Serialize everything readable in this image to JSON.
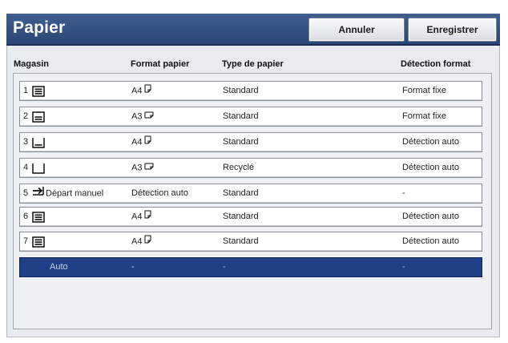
{
  "window": {
    "title": "Papier"
  },
  "buttons": {
    "cancel": "Annuler",
    "save": "Enregistrer"
  },
  "columns": {
    "tray": "Magasin",
    "format": "Format papier",
    "type": "Type de papier",
    "detection": "Détection format"
  },
  "rows": [
    {
      "num": "1",
      "icon": "tray-level-full-icon",
      "format": "A4",
      "orientation": "portrait",
      "type": "Standard",
      "detection": "Format fixe"
    },
    {
      "num": "2",
      "icon": "tray-level-high-icon",
      "format": "A3",
      "orientation": "landscape",
      "type": "Standard",
      "detection": "Format fixe"
    },
    {
      "num": "3",
      "icon": "tray-level-low-icon",
      "format": "A4",
      "orientation": "portrait",
      "type": "Standard",
      "detection": "Détection auto"
    },
    {
      "num": "4",
      "icon": "tray-empty-icon",
      "format": "A3",
      "orientation": "landscape",
      "type": "Recyclé",
      "detection": "Détection auto"
    },
    {
      "num": "5",
      "icon": "manual-feed-arrow-icon",
      "tray_name": "Départ manuel",
      "format": "Détection auto",
      "type": "Standard",
      "detection": "-"
    },
    {
      "num": "6",
      "icon": "tray-level-full-icon",
      "format": "A4",
      "orientation": "portrait",
      "type": "Standard",
      "detection": "Détection auto"
    },
    {
      "num": "7",
      "icon": "tray-level-full-icon",
      "format": "A4",
      "orientation": "portrait",
      "type": "Standard",
      "detection": "Détection auto"
    },
    {
      "num": "",
      "tray_name": "Auto",
      "format": "-",
      "type": "-",
      "detection": "-",
      "selected": true
    }
  ],
  "colors": {
    "header": "#2a4676",
    "selected_row": "#1f3f86",
    "panel": "#e8ebf0"
  }
}
